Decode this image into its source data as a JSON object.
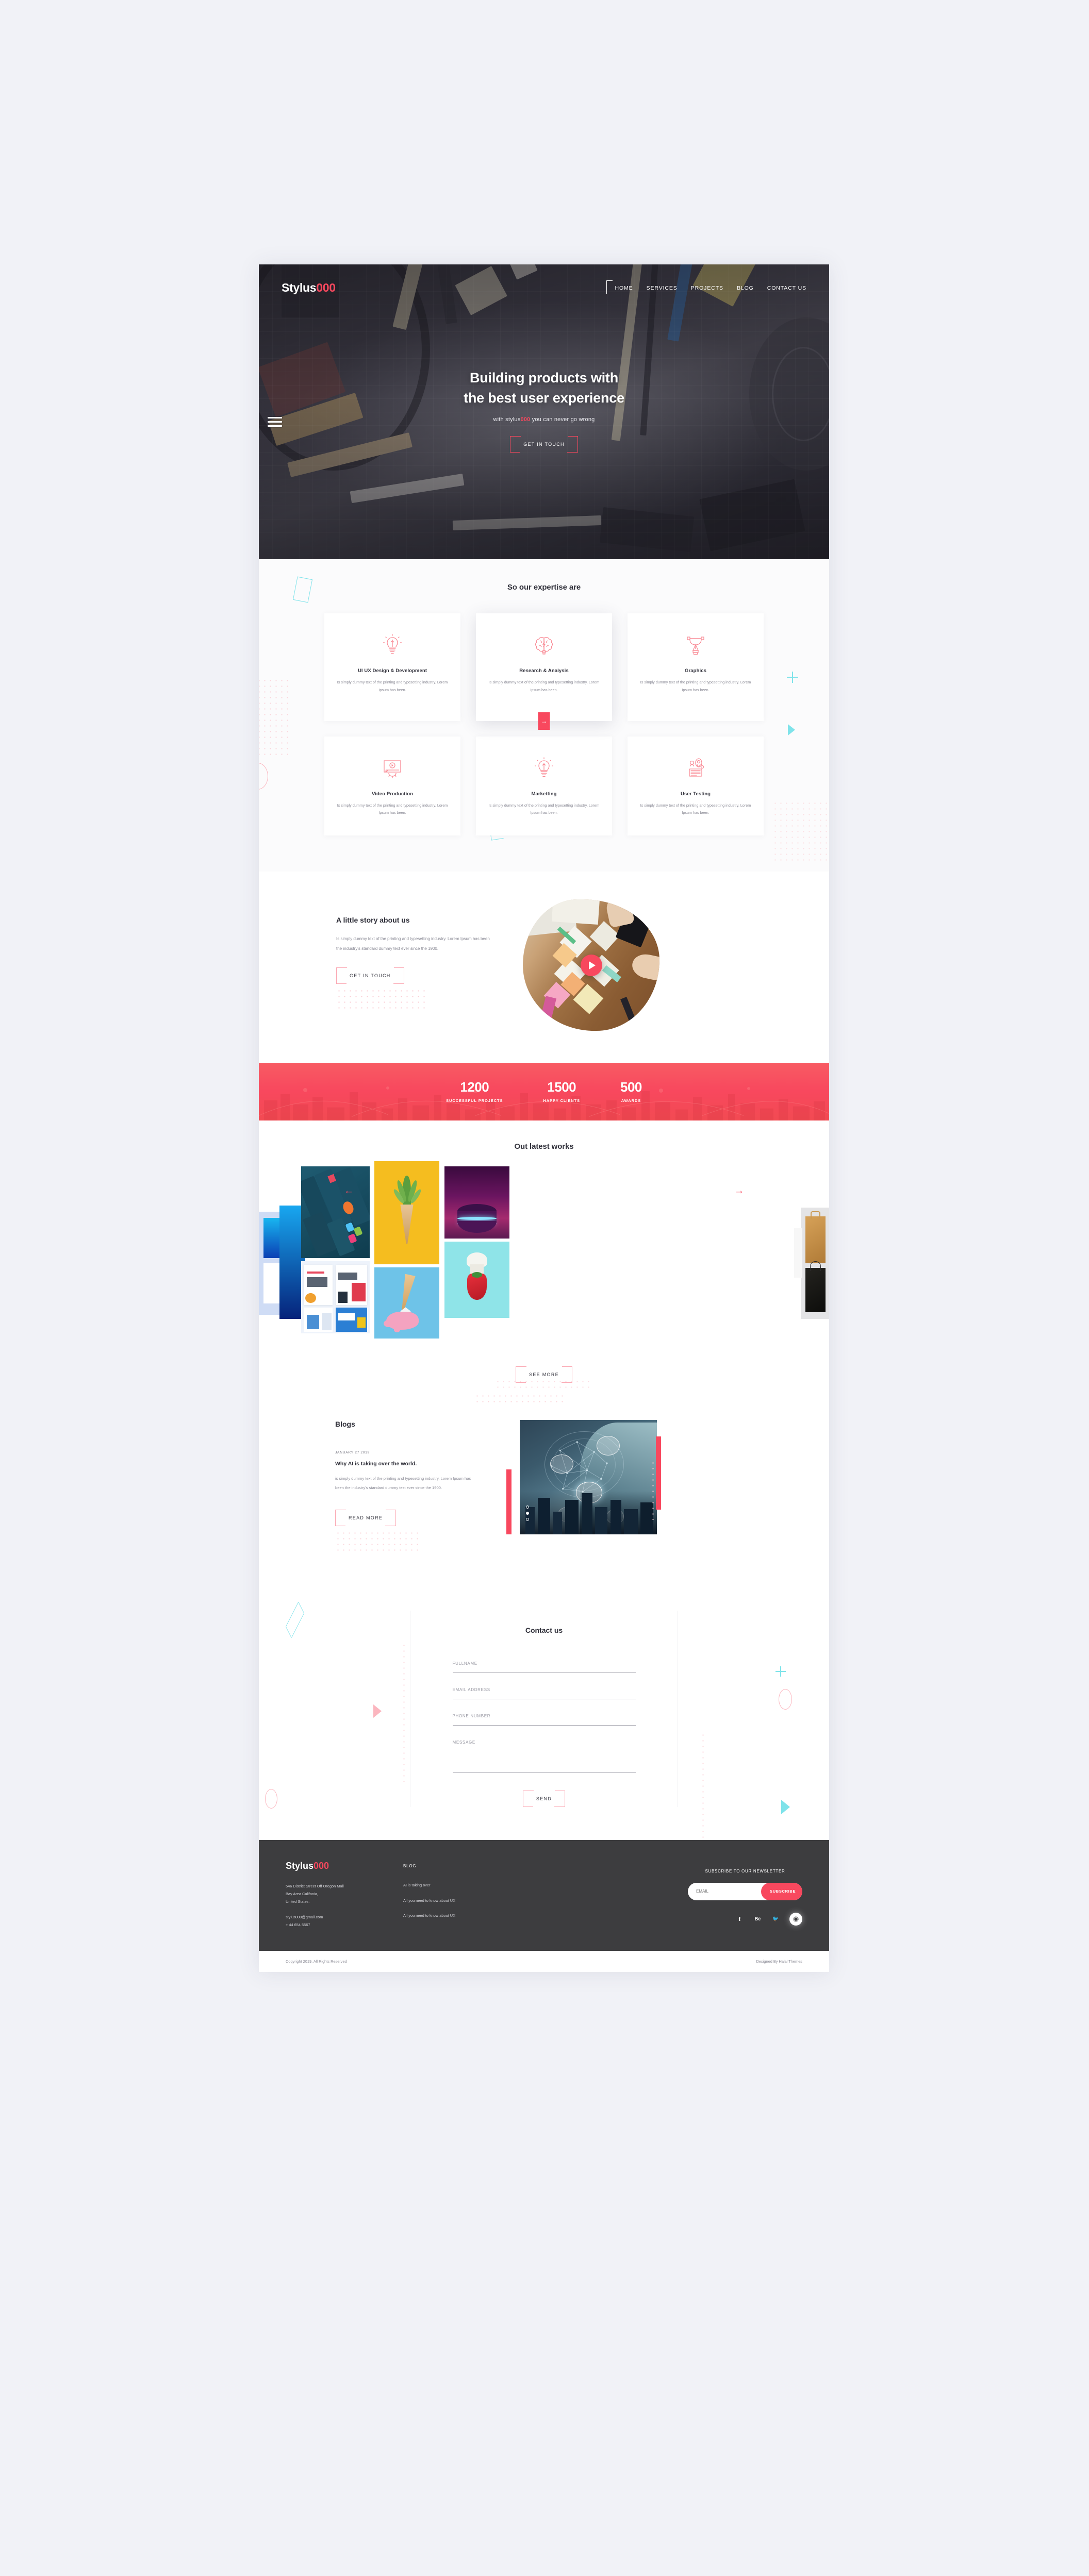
{
  "brand": {
    "name_main": "Stylus",
    "name_accent": "000",
    "accent_color": "#f8485e"
  },
  "nav": {
    "items": [
      "HOME",
      "SERVICES",
      "PROJECTS",
      "BLOG",
      "CONTACT US"
    ]
  },
  "hero": {
    "title_line1": "Building products with",
    "title_line2": "the best user experience",
    "sub_pre": "with stylus",
    "sub_accent": "000",
    "sub_post": " you can never go wrong",
    "cta": "GET IN TOUCH"
  },
  "expertise": {
    "title": "So our expertise are",
    "body": "Is simply dummy text of the printing and typesetting industry. Lorem Ipsum has been.",
    "cards": [
      {
        "title": "UI UX Design & Development",
        "icon": "lightbulb-icon",
        "featured": false
      },
      {
        "title": "Research & Analysis",
        "icon": "brain-icon",
        "featured": true
      },
      {
        "title": "Graphics",
        "icon": "pen-tool-icon",
        "featured": false
      },
      {
        "title": "Video Production",
        "icon": "video-player-icon",
        "featured": false
      },
      {
        "title": "Marketting",
        "icon": "lightbulb-icon",
        "featured": false
      },
      {
        "title": "User Testing",
        "icon": "user-testing-icon",
        "featured": false
      }
    ],
    "arrow": "→"
  },
  "story": {
    "title": "A little story about us",
    "body": "Is simply dummy text of the printing and typesetting industry. Lorem Ipsum has been the industry's standard dummy text ever since the 1900.",
    "cta": "GET IN TOUCH",
    "play": "play-button-icon"
  },
  "stats": [
    {
      "number": "1200",
      "label": "SUCCESSFUL PROJECTS"
    },
    {
      "number": "1500",
      "label": "HAPPY CLIENTS"
    },
    {
      "number": "500",
      "label": "AWARDS"
    }
  ],
  "works": {
    "title": "Out latest works",
    "prev": "←",
    "next": "→",
    "cta": "SEE MORE",
    "items": [
      {
        "name": "mobile-app-screens"
      },
      {
        "name": "pineapple-cone-yellow"
      },
      {
        "name": "neon-podium-purple"
      },
      {
        "name": "website-mockups-blue"
      },
      {
        "name": "melting-ice-cream-blue"
      },
      {
        "name": "tomato-mushroom-teal"
      },
      {
        "name": "vr-app-thumbs"
      },
      {
        "name": "shopping-bags-branding"
      }
    ]
  },
  "blogs": {
    "heading": "Blogs",
    "date": "JANUARY 27 2019",
    "title": "Why AI is taking over the world.",
    "excerpt": "is simply dummy text of the printing and typesetting industry. Lorem Ipsum has been the industry's standard dummy text ever since the 1900.",
    "cta": "READ MORE",
    "image": "ai-head-city-network"
  },
  "contact": {
    "title": "Contact us",
    "fields": [
      {
        "label": "FULLNAME",
        "placeholder": "FULLNAME",
        "value": ""
      },
      {
        "label": "EMAIL ADDRESS",
        "placeholder": "EMAIL ADDRESS",
        "value": ""
      },
      {
        "label": "PHONE NUMBER",
        "placeholder": "PHONE NUMBER",
        "value": ""
      },
      {
        "label": "MESSAGE",
        "placeholder": "MESSAGE",
        "value": ""
      }
    ],
    "submit": "SEND"
  },
  "footer": {
    "address": "546 District Street Off Oregon Mall\nBay Area Califonia,\nUnited States.",
    "email": "stylus000@gmail.com",
    "phone": "+ 44 654 5567",
    "blog_head": "BLOG",
    "blog_links": [
      "AI is taking over",
      "All you need to know about UX",
      "All you need to know about UX"
    ],
    "newsletter_head": "SUBSCRIBE TO OUR NEWSLETTER",
    "email_placeholder": "EMAIL",
    "subscribe": "SUBSCRIBE",
    "socials": [
      {
        "name": "facebook-icon",
        "glyph": "f",
        "highlight": false
      },
      {
        "name": "behance-icon",
        "glyph": "Bē",
        "highlight": false
      },
      {
        "name": "twitter-icon",
        "glyph": "🐦",
        "highlight": false
      },
      {
        "name": "dribbble-icon",
        "glyph": "◉",
        "highlight": true
      }
    ]
  },
  "copyright": {
    "left": "Copyright 2019. All Rights Reserved",
    "right": "Designed By Halal Themes"
  }
}
